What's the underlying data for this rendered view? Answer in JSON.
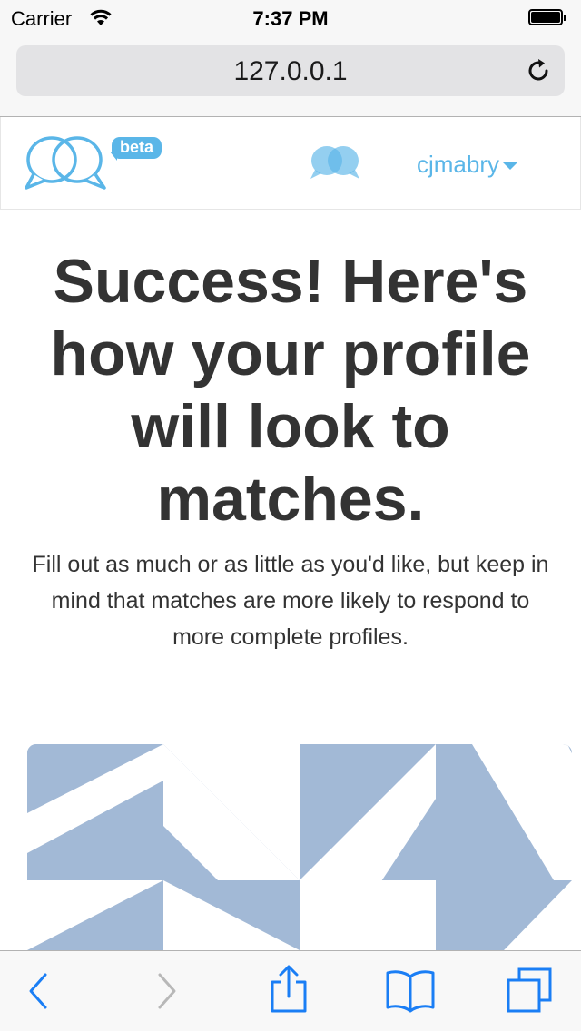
{
  "status_bar": {
    "carrier": "Carrier",
    "time": "7:37 PM"
  },
  "browser": {
    "url": "127.0.0.1"
  },
  "header": {
    "beta_label": "beta",
    "username": "cjmabry"
  },
  "main": {
    "headline": "Success! Here's how your profile will look to matches.",
    "subtext": "Fill out as much or as little as you'd like, but keep in mind that matches are more likely to respond to more complete profiles."
  },
  "colors": {
    "accent": "#5ab6e8",
    "text": "#333333",
    "cover_bg": "#a2b9d6",
    "ios_blue": "#1a7ef5"
  },
  "icons": {
    "wifi": "wifi-icon",
    "battery": "battery-icon",
    "reload": "reload-icon",
    "logo": "speech-bubbles-logo-icon",
    "messages": "messages-icon",
    "back": "back-arrow-icon",
    "forward": "forward-arrow-icon",
    "share": "share-icon",
    "bookmarks": "bookmarks-icon",
    "tabs": "tabs-icon"
  }
}
